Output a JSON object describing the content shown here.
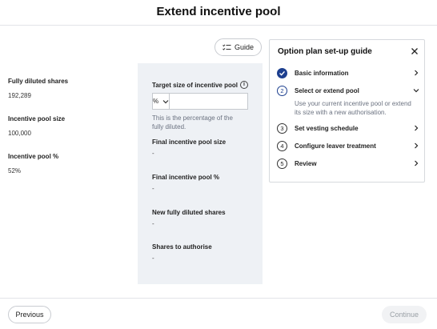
{
  "header": {
    "title": "Extend incentive pool"
  },
  "stats": [
    {
      "label": "Fully diluted shares",
      "value": "192,289"
    },
    {
      "label": "Incentive pool size",
      "value": "100,000"
    },
    {
      "label": "Incentive pool %",
      "value": "52%"
    }
  ],
  "guide_button": {
    "label": "Guide",
    "icon": "list-checks-icon"
  },
  "form": {
    "target_label": "Target size of incentive pool",
    "unit_value": "%",
    "target_value": "",
    "help_text": "This is the percentage of the fully diluted.",
    "final_size_label": "Final incentive pool size",
    "final_size_value": "-",
    "final_pct_label": "Final incentive pool %",
    "final_pct_value": "-",
    "new_fd_label": "New fully diluted shares",
    "new_fd_value": "-",
    "shares_auth_label": "Shares to authorise",
    "shares_auth_value": "-"
  },
  "guide_panel": {
    "title": "Option plan set-up guide",
    "steps": [
      {
        "num": "",
        "label": "Basic information",
        "status": "complete"
      },
      {
        "num": "2",
        "label": "Select or extend pool",
        "status": "current",
        "description": "Use your current incentive pool or extend its size with a new authorisation."
      },
      {
        "num": "3",
        "label": "Set vesting schedule",
        "status": "pending"
      },
      {
        "num": "4",
        "label": "Configure leaver treatment",
        "status": "pending"
      },
      {
        "num": "5",
        "label": "Review",
        "status": "pending"
      }
    ]
  },
  "footer": {
    "previous_label": "Previous",
    "continue_label": "Continue"
  },
  "colors": {
    "accent": "#1d3f8f",
    "panel_bg": "#eef1f5",
    "muted_text": "#6b7280"
  }
}
